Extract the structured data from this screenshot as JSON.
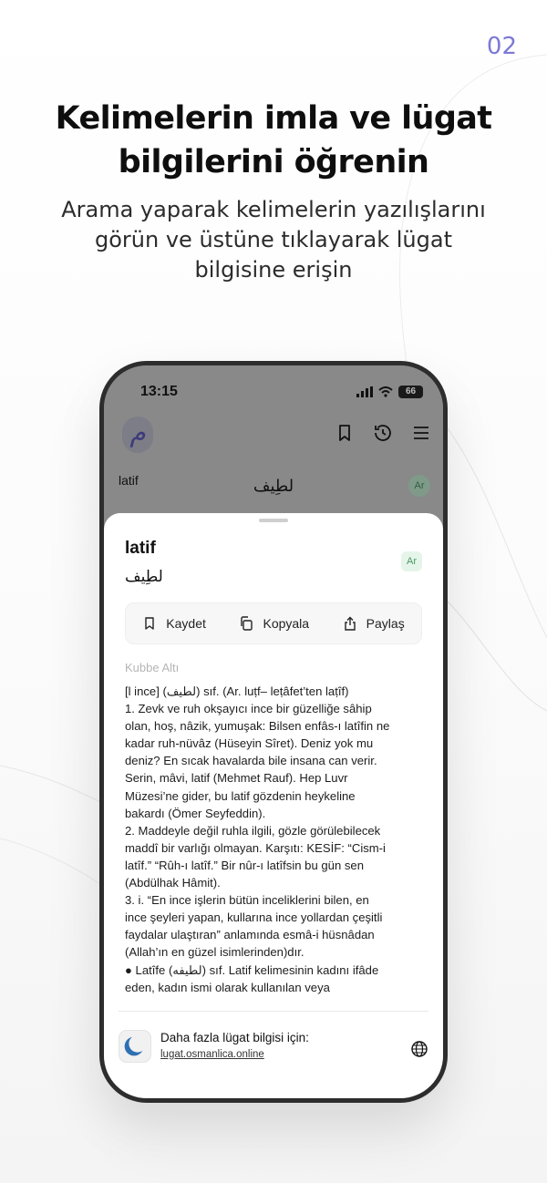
{
  "page_number": "02",
  "headline": [
    "Kelimelerin imla ve lügat",
    "bilgilerini öğrenin"
  ],
  "subtitle": [
    "Arama yaparak kelimelerin yazılışlarını",
    "görün ve üstüne tıklayarak lügat",
    "bilgisine erişin"
  ],
  "status_bar": {
    "time": "13:15",
    "battery": "66"
  },
  "app": {
    "logo_glyph": "م"
  },
  "background_result": {
    "word": "latif",
    "arabic": "لطِيف",
    "lang_badge": "Ar"
  },
  "sheet": {
    "word": "latif",
    "arabic": "لطِيف",
    "lang_badge": "Ar",
    "actions": {
      "save": "Kaydet",
      "copy": "Kopyala",
      "share": "Paylaş"
    },
    "source": "Kubbe Altı",
    "definition_lines": [
      "[l ince] (لطيف) sıf. (Ar. luṭf– leṭâfet’ten laṭîf)",
      "1. Zevk ve ruh okşayıcı ince bir güzelliğe sâhip",
      "olan, hoş, nâzik, yumuşak: Bilsen enfâs-ı latîfin ne",
      "kadar ruh-nüvâz (Hüseyin Sîret). Deniz yok mu",
      "deniz? En sıcak havalarda bile insana can verir.",
      "Serin, mâvi, latif (Mehmet Rauf). Hep Luvr",
      "Müzesi’ne gider, bu latif gözdenin heykeline",
      "bakardı (Ömer Seyfeddin).",
      "2. Maddeyle değil ruhla ilgili, gözle görülebilecek",
      "maddî bir varlığı olmayan. Karşıtı: KESİF: “Cism-i",
      "latîf.” “Rûh-ı latîf.” Bir nûr-ı latîfsin bu gün sen",
      "(Abdülhak Hâmit).",
      "3. i. “En ince işlerin bütün inceliklerini bilen, en",
      "ince şeyleri yapan, kullarına ince yollardan çeşitli",
      "faydalar ulaştıran” anlamında esmâ-i hüsnâdan",
      "(Allah’ın en güzel isimlerinden)dır.",
      "● Latîfe (لطيفه) sıf. Latif kelimesinin kadını ifâde",
      "eden, kadın ismi olarak kullanılan veya"
    ],
    "footer": {
      "text": "Daha fazla lügat bilgisi için:",
      "link": "lugat.osmanlica.online"
    }
  },
  "colors": {
    "accent": "#7b79d6",
    "badge_bg": "#e6f5ea",
    "badge_text": "#4a9a63",
    "logo_blue": "#2f6fb3"
  },
  "icons": [
    "bookmark-icon",
    "history-icon",
    "menu-icon",
    "copy-icon",
    "share-icon",
    "globe-icon",
    "crescent-logo-icon"
  ]
}
